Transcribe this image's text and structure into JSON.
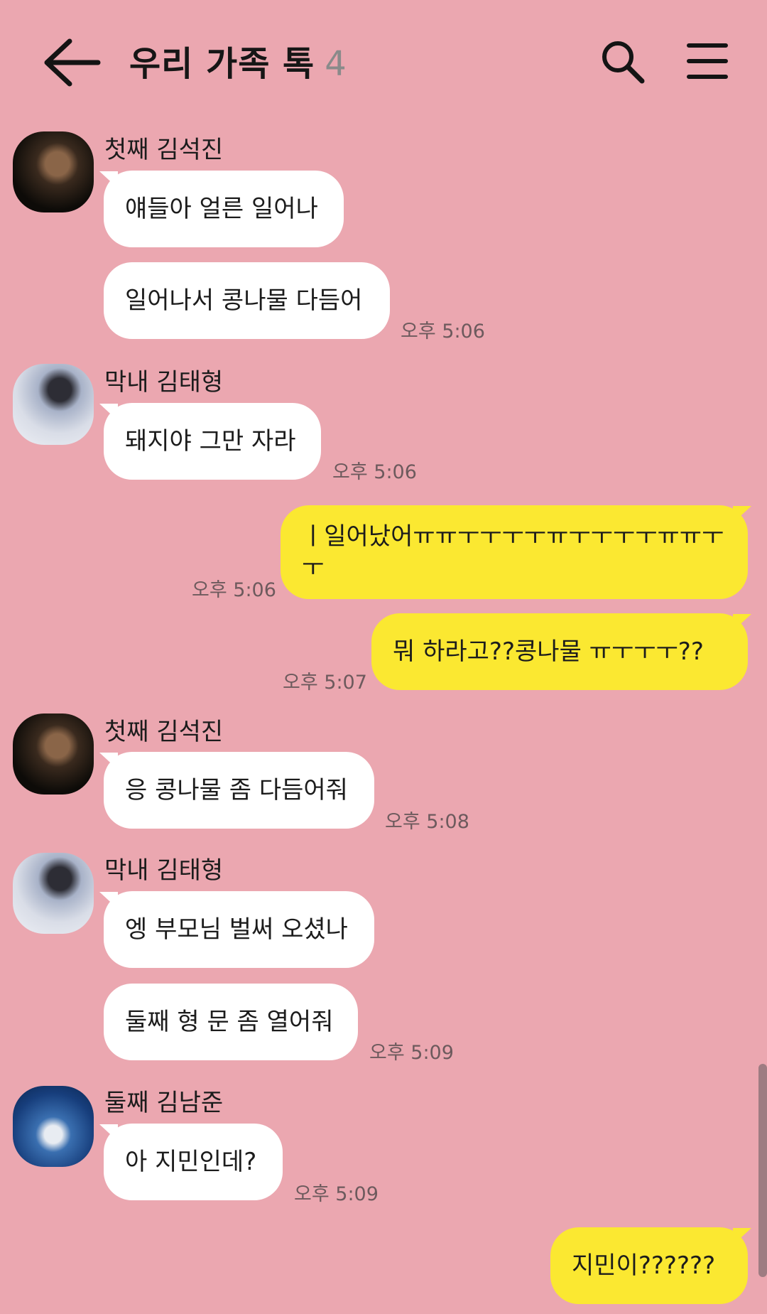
{
  "header": {
    "back_icon": "arrow-left-icon",
    "title": "우리 가족 톡",
    "member_count": "4",
    "search_icon": "search-icon",
    "menu_icon": "hamburger-menu-icon"
  },
  "messages": [
    {
      "sender": "첫째 김석진",
      "bubbles": [
        "얘들아 얼른 일어나",
        "일어나서 콩나물 다듬어"
      ],
      "time": "오후 5:06"
    },
    {
      "sender": "막내 김태형",
      "bubbles": [
        "돼지야 그만 자라"
      ],
      "time": "오후 5:06"
    },
    {
      "mine": true,
      "line1": "ㅣ일어났어ㅠㅠㅜㅜㅜㅜㅠㅜㅜㅜㅜㅠㅠㅜ",
      "line2": "ㅜ",
      "time": "오후 5:06"
    },
    {
      "mine": true,
      "text": "뭐 하라고??콩나물 ㅠㅜㅜㅜ??",
      "time": "오후 5:07"
    },
    {
      "sender": "첫째 김석진",
      "bubbles": [
        "응 콩나물 좀 다듬어줘"
      ],
      "time": "오후 5:08"
    },
    {
      "sender": "막내 김태형",
      "bubbles": [
        "엥 부모님 벌써 오셨나",
        "둘째 형 문 좀 열어줘"
      ],
      "time": "오후 5:09"
    },
    {
      "sender": "둘째 김남준",
      "bubbles": [
        "아 지민인데?"
      ],
      "time": "오후 5:09"
    },
    {
      "mine": true,
      "text": "지민이??????"
    }
  ],
  "colors": {
    "background": "#eba7b0",
    "incoming_bubble": "#ffffff",
    "outgoing_bubble": "#fbe831",
    "muted": "#8a8a8a"
  }
}
